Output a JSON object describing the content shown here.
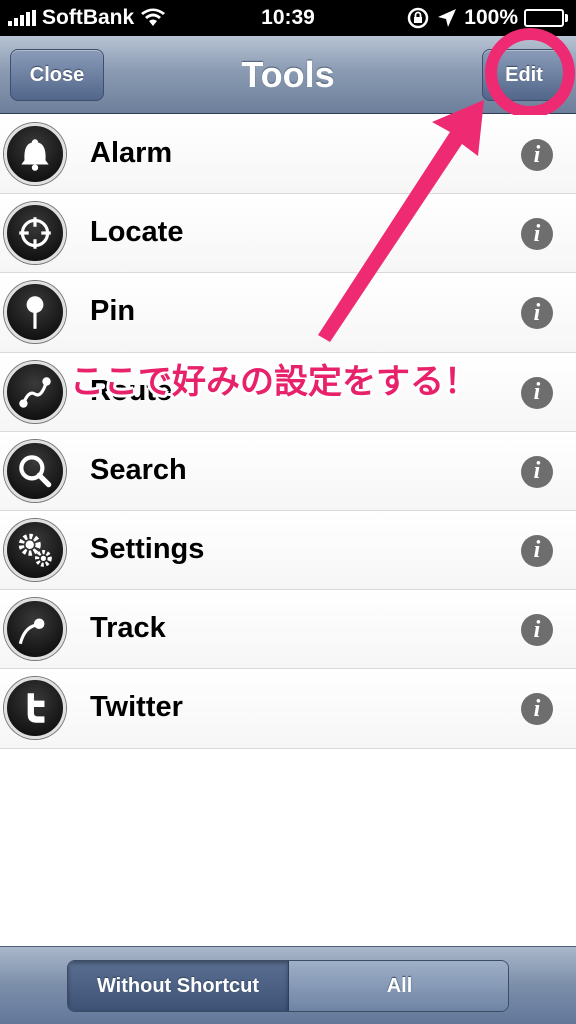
{
  "status_bar": {
    "carrier": "SoftBank",
    "time": "10:39",
    "battery_percent": "100%",
    "battery_level": 1.0
  },
  "nav": {
    "close_label": "Close",
    "title": "Tools",
    "edit_label": "Edit"
  },
  "tools": [
    {
      "label": "Alarm",
      "icon": "bell-icon"
    },
    {
      "label": "Locate",
      "icon": "crosshair-icon"
    },
    {
      "label": "Pin",
      "icon": "pin-icon"
    },
    {
      "label": "Route",
      "icon": "route-icon"
    },
    {
      "label": "Search",
      "icon": "magnifier-icon"
    },
    {
      "label": "Settings",
      "icon": "gears-icon"
    },
    {
      "label": "Track",
      "icon": "track-icon"
    },
    {
      "label": "Twitter",
      "icon": "twitter-icon"
    }
  ],
  "info_glyph": "i",
  "annotation": {
    "text": "ここで好みの設定をする！",
    "color": "#ee2a73"
  },
  "segmented": {
    "selected_label": "Without Shortcut",
    "other_label": "All"
  }
}
